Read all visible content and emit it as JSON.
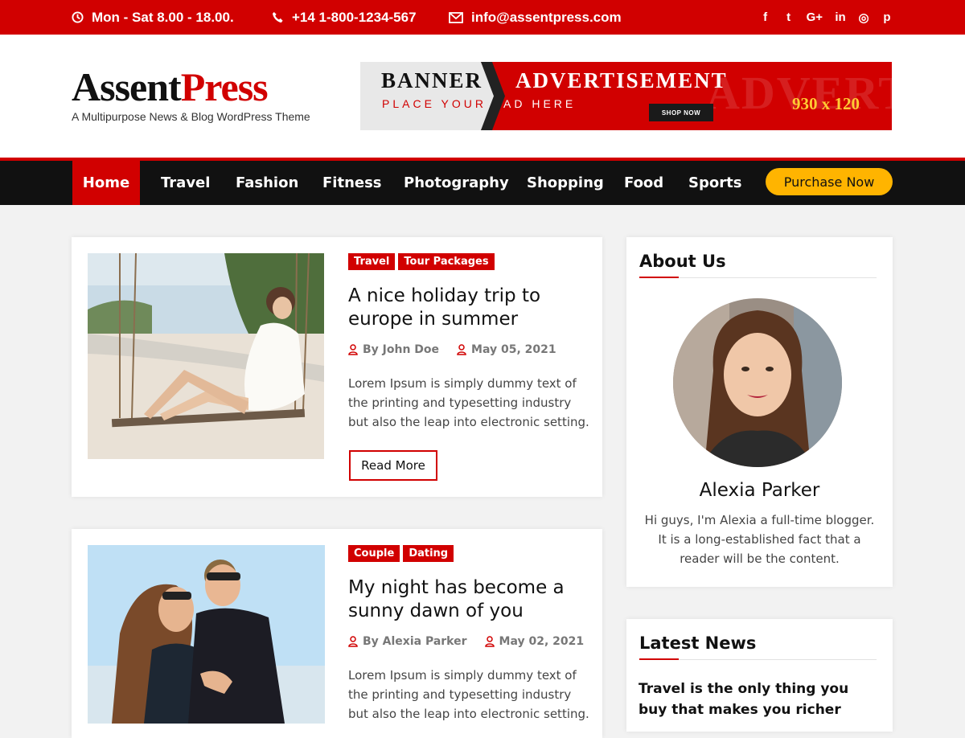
{
  "topbar": {
    "hours": "Mon - Sat 8.00 - 18.00.",
    "phone": "+14 1-800-1234-567",
    "email": "info@assentpress.com",
    "social_icons": [
      "facebook-icon",
      "twitter-icon",
      "google-plus-icon",
      "linkedin-icon",
      "instagram-icon",
      "pinterest-icon"
    ],
    "social_glyphs": [
      "f",
      "t",
      "G+",
      "in",
      "◎",
      "p"
    ]
  },
  "brand": {
    "logo_part1": "Assent",
    "logo_part2": "Press",
    "tagline": "A Multipurpose News & Blog WordPress Theme"
  },
  "banner": {
    "word1": "BANNER",
    "word2": "ADVERTISEMENT",
    "line2a": "PLACE YOUR",
    "line2b": "AD HERE",
    "size": "930 x 120",
    "button": "SHOP NOW",
    "ghost": "ADVERTISEMENT"
  },
  "nav": {
    "items": [
      "Home",
      "Travel",
      "Fashion",
      "Fitness",
      "Photography",
      "Shopping",
      "Food",
      "Sports"
    ],
    "active": "Home",
    "purchase": "Purchase Now"
  },
  "posts": [
    {
      "tags": [
        "Travel",
        "Tour Packages"
      ],
      "title": "A nice holiday trip to europe in summer",
      "author": "By John Doe",
      "date": "May 05, 2021",
      "excerpt": "Lorem Ipsum is simply dummy text of the printing and typesetting industry but also the leap into electronic setting.",
      "read_more": "Read More"
    },
    {
      "tags": [
        "Couple",
        "Dating"
      ],
      "title": "My night has become a sunny dawn of you",
      "author": "By Alexia Parker",
      "date": "May 02, 2021",
      "excerpt": "Lorem Ipsum is simply dummy text of the printing and typesetting industry but also the leap into electronic setting."
    }
  ],
  "about": {
    "title": "About Us",
    "name": "Alexia Parker",
    "bio": "Hi guys, I'm Alexia a full-time blogger. It is a long-established fact that a reader will be the content."
  },
  "latest": {
    "title": "Latest News",
    "first_headline": "Travel is the only thing you buy that makes you richer"
  },
  "colors": {
    "accent": "#d10000",
    "nav_bg": "#111111",
    "purchase_bg": "#ffb400"
  }
}
